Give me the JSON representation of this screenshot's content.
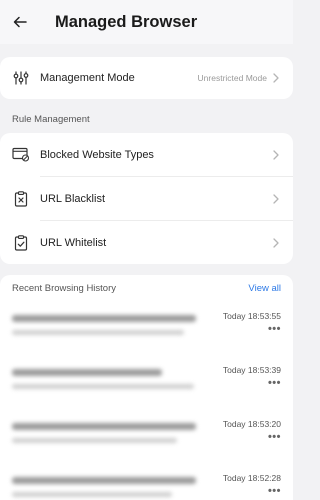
{
  "header": {
    "title": "Managed Browser"
  },
  "management": {
    "label": "Management Mode",
    "value": "Unrestricted Mode"
  },
  "rule_section": {
    "title": "Rule Management"
  },
  "rules": [
    {
      "label": "Blocked Website Types"
    },
    {
      "label": "URL Blacklist"
    },
    {
      "label": "URL Whitelist"
    }
  ],
  "history": {
    "title": "Recent Browsing History",
    "view_all": "View all",
    "items": [
      {
        "time": "Today 18:53:55",
        "more": "•••"
      },
      {
        "time": "Today 18:53:39",
        "more": "•••"
      },
      {
        "time": "Today 18:53:20",
        "more": "•••"
      },
      {
        "time": "Today 18:52:28",
        "more": "•••"
      }
    ]
  },
  "colors": {
    "accent": "#2e7ae6",
    "background": "#f2f2f4",
    "card": "#ffffff"
  }
}
